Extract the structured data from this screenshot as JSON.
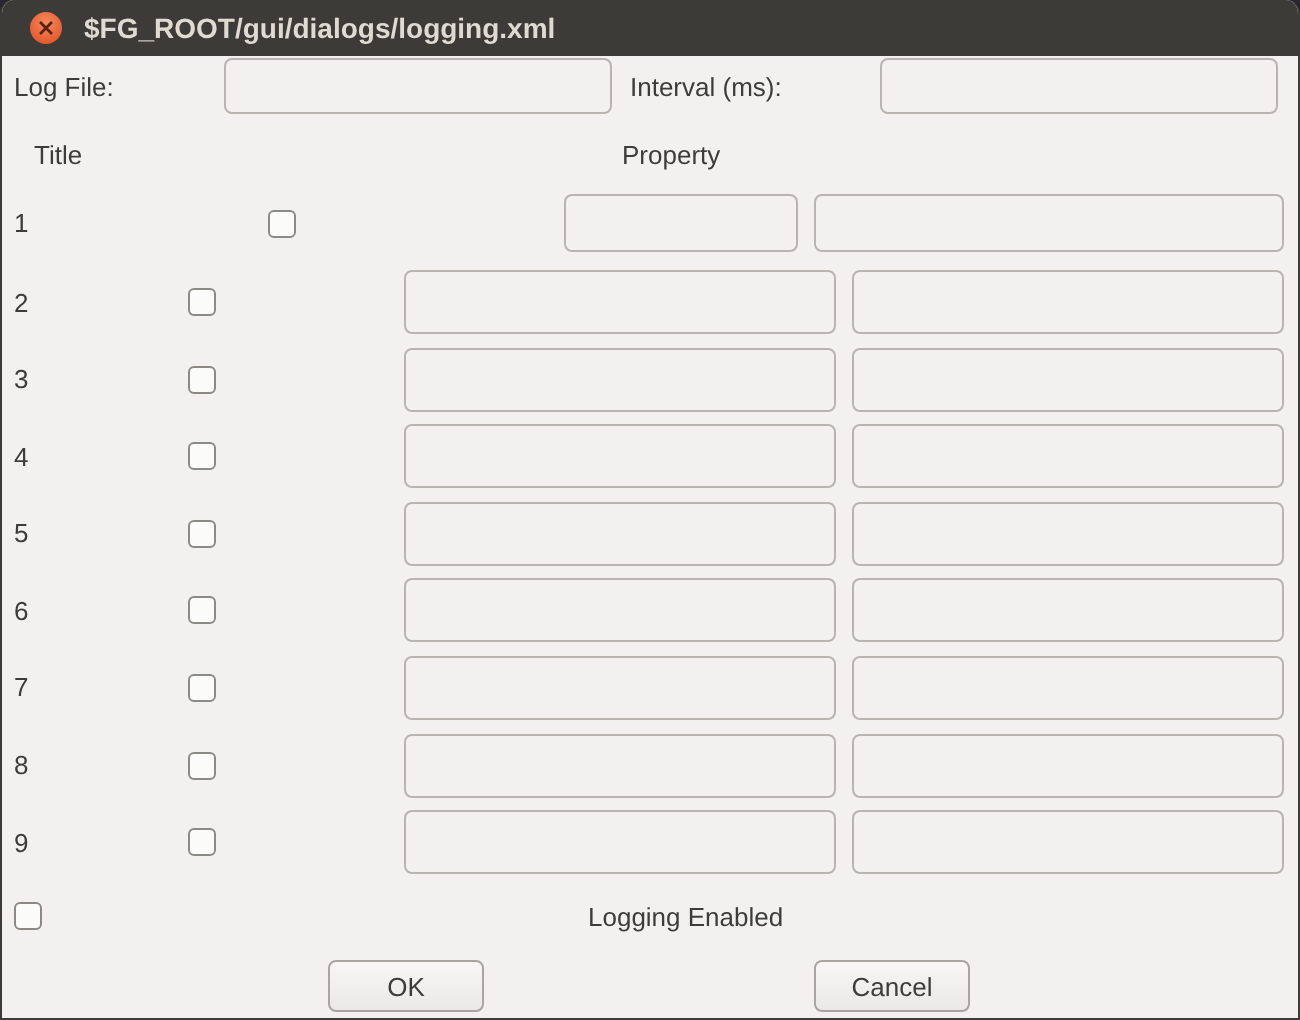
{
  "window": {
    "title": "$FG_ROOT/gui/dialogs/logging.xml"
  },
  "log_file": {
    "label": "Log File:"
  },
  "interval": {
    "label": "Interval (ms):"
  },
  "headers": {
    "title": "Title",
    "property": "Property"
  },
  "rows": [
    {
      "label": "1",
      "checked": false,
      "kind": "compact"
    },
    {
      "label": "2",
      "checked": false,
      "kind": "wide"
    },
    {
      "label": "3",
      "checked": false,
      "kind": "wide"
    },
    {
      "label": "4",
      "checked": false,
      "kind": "wide"
    },
    {
      "label": "5",
      "checked": false,
      "kind": "wide"
    },
    {
      "label": "6",
      "checked": false,
      "kind": "wide"
    },
    {
      "label": "7",
      "checked": false,
      "kind": "wide"
    },
    {
      "label": "8",
      "checked": false,
      "kind": "wide"
    },
    {
      "label": "9",
      "checked": false,
      "kind": "wide"
    }
  ],
  "logging_enabled": {
    "label": "Logging Enabled",
    "checked": false
  },
  "buttons": [
    "OK",
    "Cancel"
  ]
}
